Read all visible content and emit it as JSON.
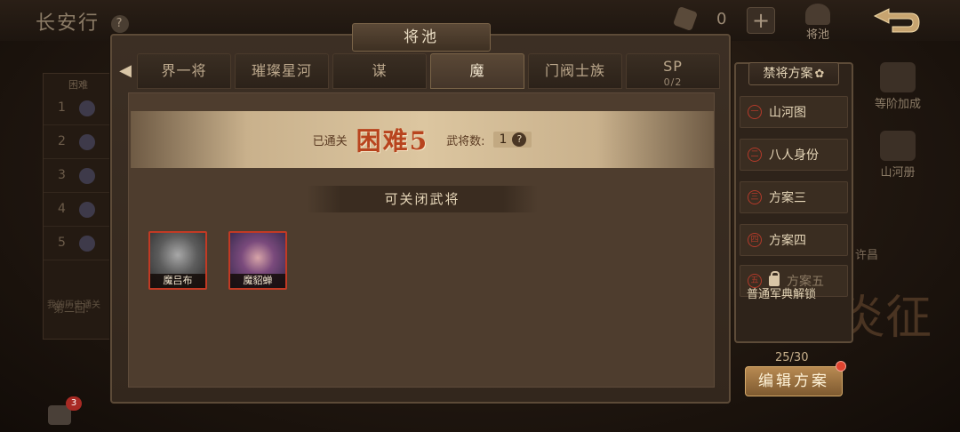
{
  "header": {
    "game_title": "长安行",
    "help": "?",
    "currency_count": "0",
    "plus": "+",
    "pool_nav_label": "将池"
  },
  "background": {
    "board_header": "困难",
    "board_rows": [
      "1",
      "2",
      "3",
      "4",
      "5"
    ],
    "board_text": "我的历史通关",
    "round_text": "第二回:",
    "chat_badge": "3",
    "side_items": [
      "等阶加成",
      "山河册"
    ],
    "city": "许昌",
    "calligraphy": "炎征"
  },
  "modal": {
    "title": "将池",
    "tabs": [
      {
        "label": "界一将",
        "active": false
      },
      {
        "label": "璀璨星河",
        "active": false
      },
      {
        "label": "谋",
        "active": false
      },
      {
        "label": "魔",
        "active": true
      },
      {
        "label": "门阀士族",
        "active": false
      },
      {
        "label": "SP",
        "sub": "0/2",
        "active": false
      }
    ],
    "banner": {
      "cleared_label": "已通关",
      "difficulty": "困难5",
      "count_label": "武将数:",
      "count_value": "1",
      "count_help": "?"
    },
    "section_title": "可关闭武将",
    "generals": [
      {
        "name": "魔吕布"
      },
      {
        "name": "魔貂蝉"
      }
    ]
  },
  "ban_panel": {
    "title": "禁将方案",
    "schemes": [
      {
        "num": "一",
        "label": "山河图"
      },
      {
        "num": "二",
        "label": "八人身份"
      },
      {
        "num": "三",
        "label": "方案三"
      },
      {
        "num": "四",
        "label": "方案四"
      },
      {
        "num": "五",
        "label": "方案五",
        "locked": true
      }
    ],
    "unlock_hint": "普通军典解锁",
    "progress": "25/30",
    "edit_label": "编辑方案"
  },
  "colors": {
    "accent": "#b8441e",
    "frame": "#5d4b38",
    "active_tab": "#5a4836",
    "button": "#b88a52"
  }
}
